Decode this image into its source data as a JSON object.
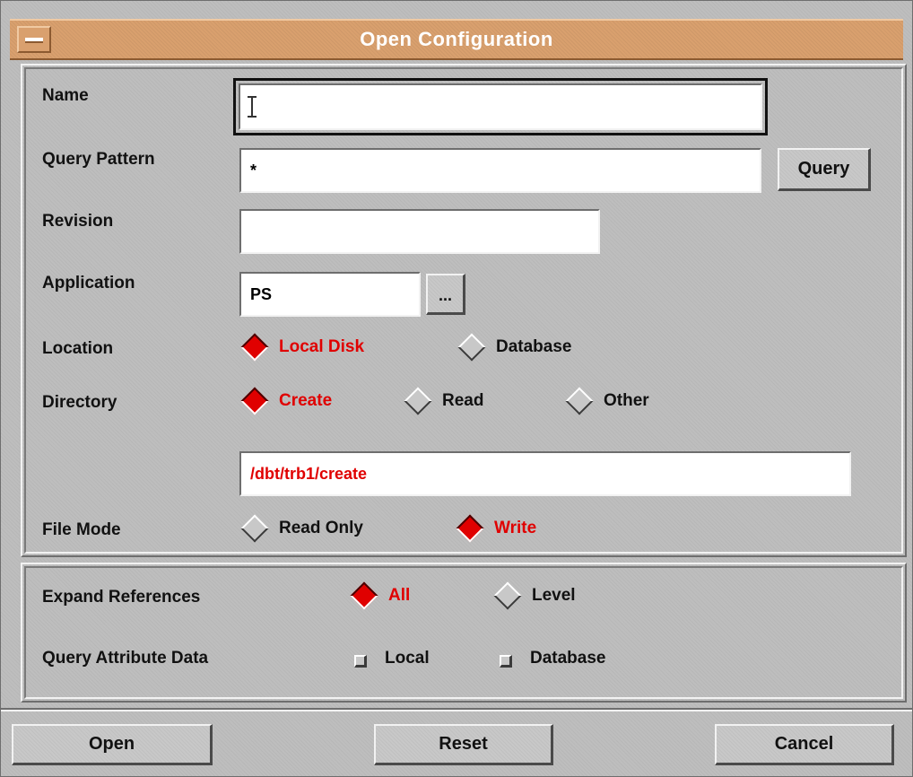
{
  "window": {
    "title": "Open Configuration"
  },
  "fields": {
    "name": {
      "label": "Name",
      "value": ""
    },
    "query_pattern": {
      "label": "Query Pattern",
      "value": "*",
      "button": "Query"
    },
    "revision": {
      "label": "Revision",
      "value": ""
    },
    "application": {
      "label": "Application",
      "value": "PS",
      "button": "..."
    },
    "location": {
      "label": "Location",
      "options": [
        "Local Disk",
        "Database"
      ],
      "selected": "Local Disk"
    },
    "directory": {
      "label": "Directory",
      "options": [
        "Create",
        "Read",
        "Other"
      ],
      "selected": "Create",
      "path": "/dbt/trb1/create"
    },
    "file_mode": {
      "label": "File Mode",
      "options": [
        "Read Only",
        "Write"
      ],
      "selected": "Write"
    }
  },
  "references": {
    "expand": {
      "label": "Expand References",
      "options": [
        "All",
        "Level"
      ],
      "selected": "All"
    },
    "query_attr": {
      "label": "Query Attribute Data",
      "options": [
        "Local",
        "Database"
      ],
      "checked": []
    }
  },
  "buttons": {
    "open": "Open",
    "reset": "Reset",
    "cancel": "Cancel"
  },
  "colors": {
    "title_bar": "#d9a06e",
    "selected": "#e00000",
    "background": "#bebebe"
  }
}
